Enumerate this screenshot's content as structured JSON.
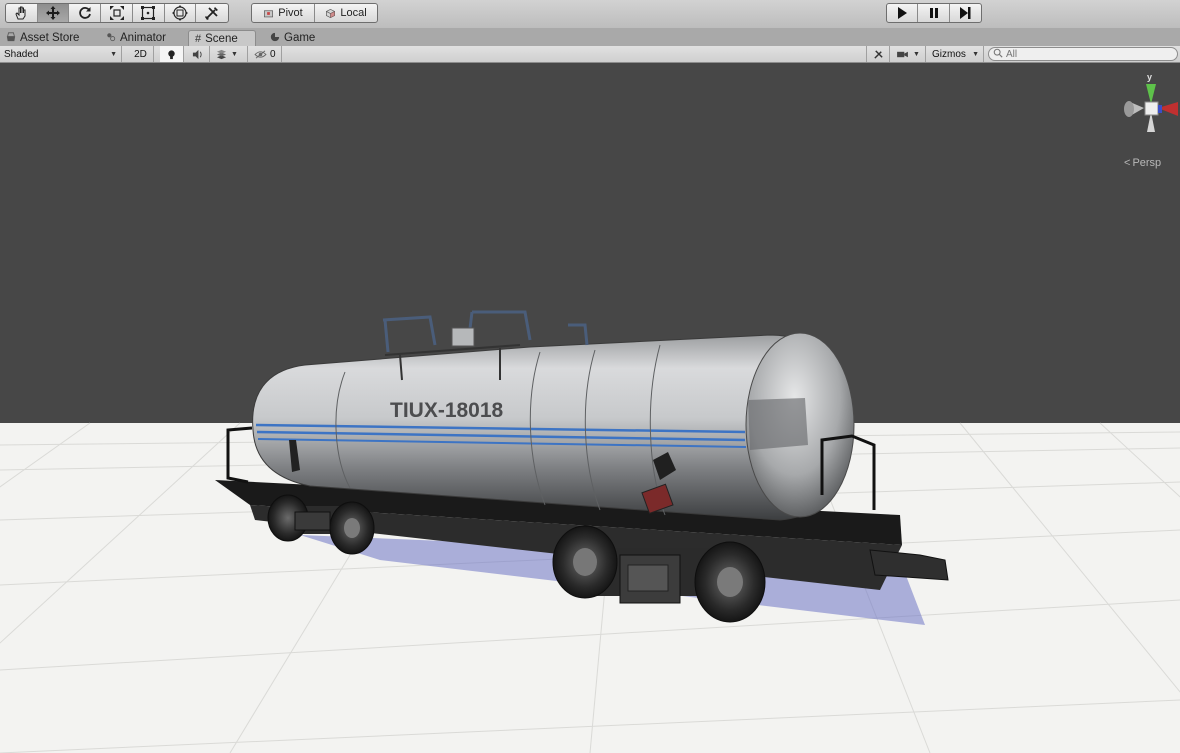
{
  "toolbar": {
    "tools": [
      "hand-tool",
      "move-tool",
      "rotate-tool",
      "scale-tool",
      "rect-tool",
      "transform-tool",
      "custom-tool"
    ],
    "pivot_label": "Pivot",
    "local_label": "Local",
    "play_controls": [
      "play",
      "pause",
      "step"
    ]
  },
  "tabs": [
    {
      "label": "Asset Store",
      "icon": "store-icon",
      "active": false
    },
    {
      "label": "Animator",
      "icon": "animator-icon",
      "active": false
    },
    {
      "label": "Scene",
      "icon": "grid-icon",
      "active": true
    },
    {
      "label": "Game",
      "icon": "game-icon",
      "active": false
    }
  ],
  "scene_toolbar": {
    "draw_mode": "Shaded",
    "mode_2d": "2D",
    "hidden_count": "0",
    "gizmos_label": "Gizmos",
    "search_placeholder": "All"
  },
  "scene": {
    "tanker_marking": "TIUX-18018",
    "gizmo_axis_label": "y",
    "projection_label": "Persp"
  },
  "colors": {
    "sky": "#474747",
    "ground": "#f3f3f1",
    "stripe": "#3d74c4",
    "gizmo_y": "#5ec24a",
    "gizmo_x": "#c03030",
    "gizmo_z": "#3a4fc8"
  }
}
